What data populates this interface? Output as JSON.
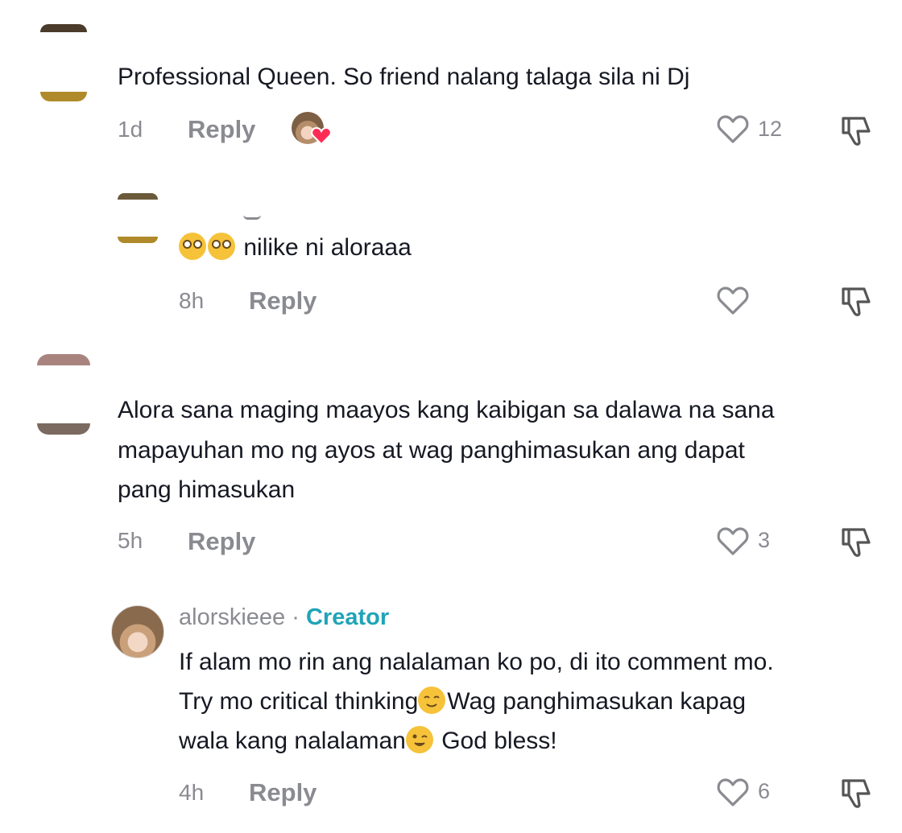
{
  "comments": [
    {
      "text": "Professional Queen. So friend nalang talaga sila ni Dj",
      "time": "1d",
      "reply_label": "Reply",
      "likes": "12"
    },
    {
      "text": "nilike ni aloraaa",
      "time": "8h",
      "reply_label": "Reply",
      "likes": ""
    },
    {
      "text_lines": [
        "Alora sana maging maayos kang kaibigan sa dalawa na sana",
        "mapayuhan mo ng ayos at wag panghimasukan ang dapat",
        "pang himasukan"
      ],
      "time": "5h",
      "reply_label": "Reply",
      "likes": "3"
    },
    {
      "username": "alorskieee",
      "separator": "·",
      "badge": "Creator",
      "text_lines": [
        "If alam mo rin ang nalalaman ko po, di ito comment mo.",
        "Try mo critical thinking",
        "Wag panghimasukan kapag",
        "wala kang nalalaman",
        "God bless!"
      ],
      "time": "4h",
      "reply_label": "Reply",
      "likes": "6"
    }
  ],
  "icons": [
    "heart-icon",
    "dislike-icon",
    "creator-heart-icon",
    "flushed-emoji",
    "relieved-emoji",
    "wink-emoji"
  ],
  "colors": {
    "creator": "#20a4b6",
    "muted": "#8a8b91",
    "text": "#161823",
    "heart_badge": "#fe2c55"
  }
}
